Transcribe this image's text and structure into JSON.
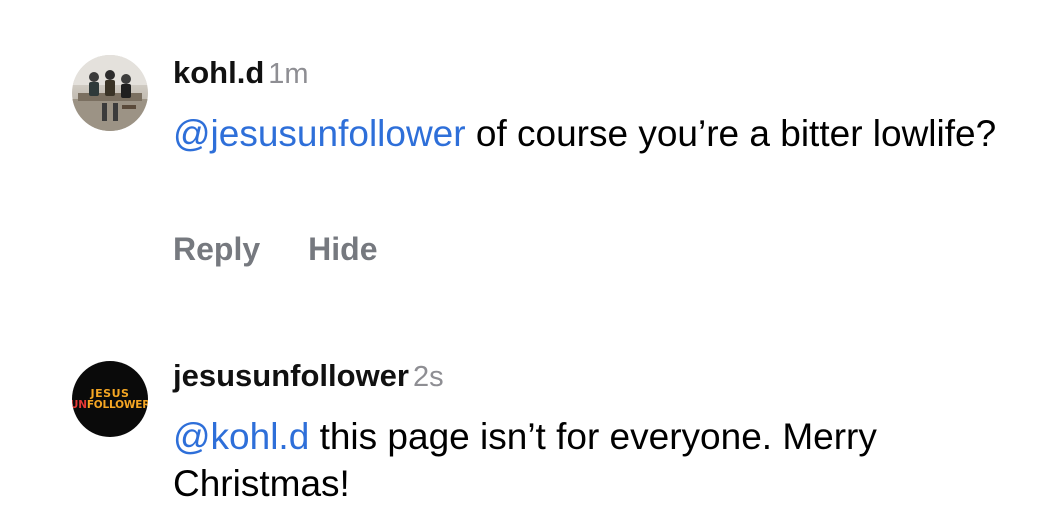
{
  "comments": [
    {
      "username": "kohl.d",
      "timestamp": "1m",
      "mention": "@jesusunfollower",
      "text": " of course you’re a bitter lowlife?",
      "actions": {
        "reply": "Reply",
        "hide": "Hide"
      }
    },
    {
      "username": "jesusunfollower",
      "timestamp": "2s",
      "mention": "@kohl.d",
      "text": " this page isn’t for everyone. Merry Christmas!",
      "avatar_logo": {
        "top": "JESUS",
        "bottom_un": "UN",
        "bottom_rest": "FOLLOWER"
      }
    }
  ],
  "colors": {
    "mention": "#2e6fd9",
    "timestamp": "#8e8e93",
    "action": "#76797f",
    "logo_orange": "#f5a623",
    "logo_red": "#e53935"
  }
}
